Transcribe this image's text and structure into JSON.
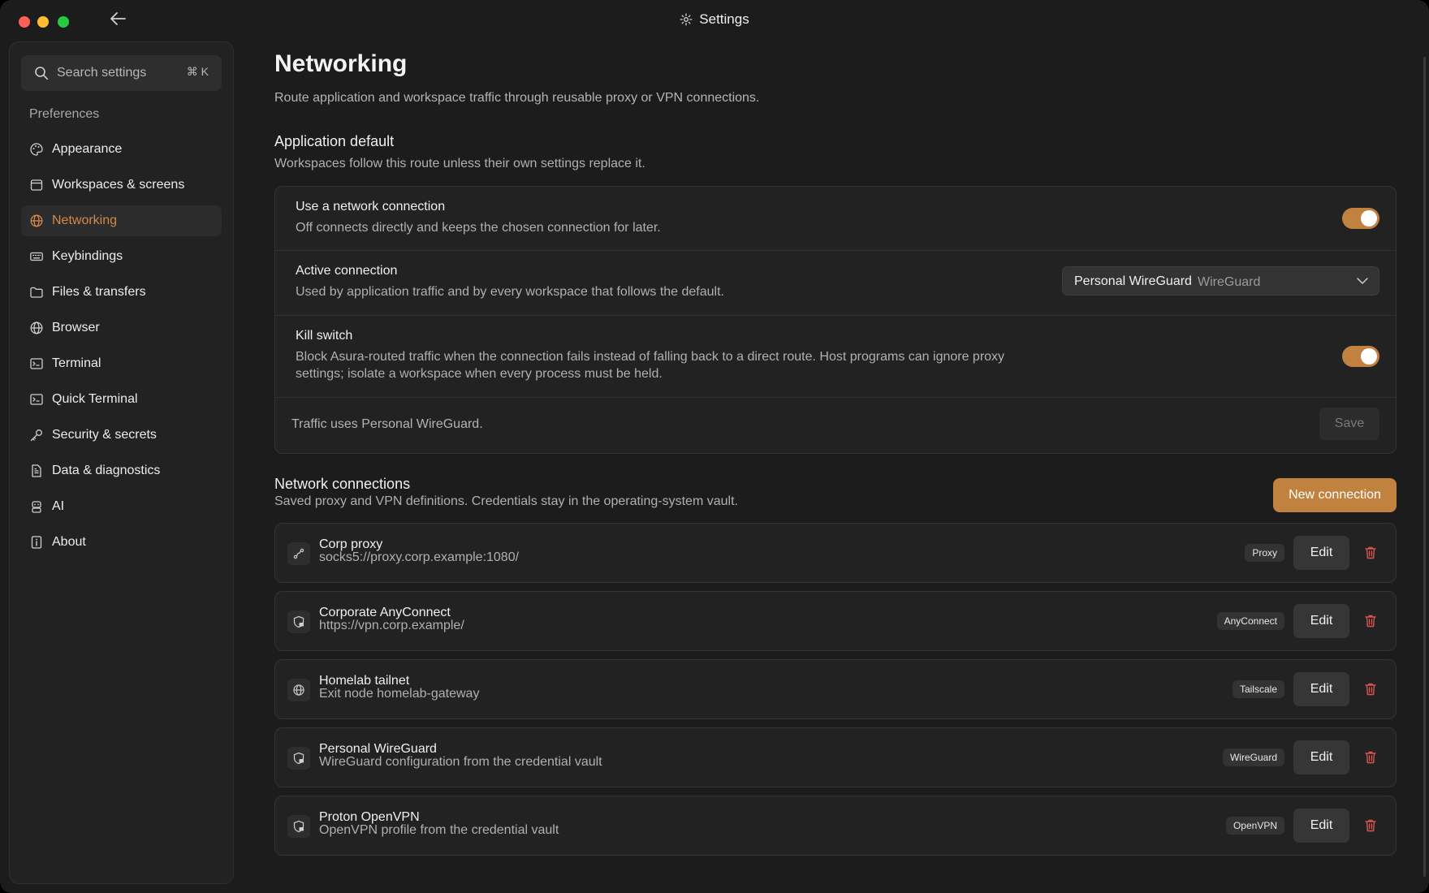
{
  "window": {
    "title": "Settings"
  },
  "sidebar": {
    "search_placeholder": "Search settings",
    "search_shortcut": "⌘ K",
    "section_label": "Preferences",
    "items": [
      {
        "label": "Appearance",
        "icon": "palette-icon"
      },
      {
        "label": "Workspaces & screens",
        "icon": "window-icon"
      },
      {
        "label": "Networking",
        "icon": "globe-icon",
        "active": true
      },
      {
        "label": "Keybindings",
        "icon": "keyboard-icon"
      },
      {
        "label": "Files & transfers",
        "icon": "folder-icon"
      },
      {
        "label": "Browser",
        "icon": "globe-icon"
      },
      {
        "label": "Terminal",
        "icon": "terminal-icon"
      },
      {
        "label": "Quick Terminal",
        "icon": "terminal-icon"
      },
      {
        "label": "Security & secrets",
        "icon": "key-icon"
      },
      {
        "label": "Data & diagnostics",
        "icon": "document-icon"
      },
      {
        "label": "AI",
        "icon": "robot-icon"
      },
      {
        "label": "About",
        "icon": "info-icon"
      }
    ]
  },
  "page": {
    "title": "Networking",
    "description": "Route application and workspace traffic through reusable proxy or VPN connections."
  },
  "app_default": {
    "heading": "Application default",
    "description": "Workspaces follow this route unless their own settings replace it.",
    "use_connection": {
      "title": "Use a network connection",
      "description": "Off connects directly and keeps the chosen connection for later.",
      "enabled": true
    },
    "active_connection": {
      "title": "Active connection",
      "description": "Used by application traffic and by every workspace that follows the default.",
      "selected_name": "Personal WireGuard",
      "selected_type": "WireGuard"
    },
    "kill_switch": {
      "title": "Kill switch",
      "description_line1": "Block Asura-routed traffic when the connection fails instead of falling back to a direct route. Host programs can ignore proxy",
      "description_line2": "settings; isolate a workspace when every process must be held.",
      "enabled": true
    },
    "status": "Traffic uses Personal WireGuard.",
    "save_label": "Save"
  },
  "connections": {
    "heading": "Network connections",
    "description": "Saved proxy and VPN definitions. Credentials stay in the operating-system vault.",
    "new_label": "New connection",
    "edit_label": "Edit",
    "items": [
      {
        "name": "Corp proxy",
        "detail": "socks5://proxy.corp.example:1080/",
        "badge": "Proxy",
        "icon": "link-icon"
      },
      {
        "name": "Corporate AnyConnect",
        "detail": "https://vpn.corp.example/",
        "badge": "AnyConnect",
        "icon": "shield-lock-icon"
      },
      {
        "name": "Homelab tailnet",
        "detail": "Exit node homelab-gateway",
        "badge": "Tailscale",
        "icon": "globe-icon"
      },
      {
        "name": "Personal WireGuard",
        "detail": "WireGuard configuration from the credential vault",
        "badge": "WireGuard",
        "icon": "shield-lock-icon"
      },
      {
        "name": "Proton OpenVPN",
        "detail": "OpenVPN profile from the credential vault",
        "badge": "OpenVPN",
        "icon": "shield-lock-icon"
      }
    ]
  },
  "colors": {
    "accent": "#c2823f",
    "danger": "#d9534f"
  }
}
